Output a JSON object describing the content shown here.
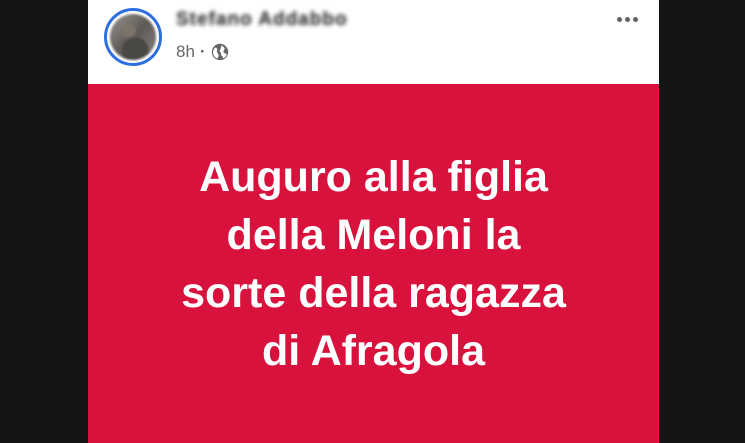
{
  "post": {
    "author_name": "Stefano Addabbo",
    "timestamp": "8h",
    "separator": "·",
    "privacy_icon": "globe-icon",
    "more_icon": "more-options-icon",
    "background_color": "#d8123c",
    "text_color": "#ffffff",
    "text_lines": [
      "Auguro alla figlia",
      "della Meloni la",
      "sorte della ragazza",
      "di Afragola"
    ]
  }
}
